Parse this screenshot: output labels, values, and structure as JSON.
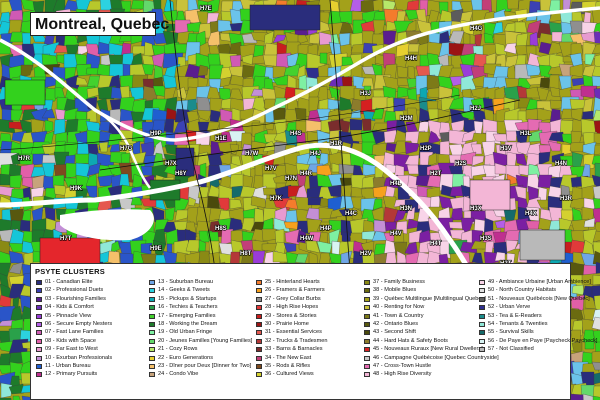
{
  "map": {
    "title": "Montreal, Quebec",
    "colors": {
      "river": "#ffffff",
      "road": "#111111",
      "island_pink": "#f3b6d6",
      "purple_core": "#7b1fa2",
      "olive": "#a3a11a",
      "green_bright": "#33d11d",
      "green_dark": "#1e7b2b",
      "yellow_green": "#b8c82b",
      "red": "#e4262c",
      "blue": "#2a55c8",
      "sky": "#6bc3ea",
      "cyan": "#15c6d8"
    },
    "labels": [
      "H7R",
      "H7T",
      "H7G",
      "H7E",
      "H1E",
      "H7X",
      "H7W",
      "H7V",
      "H7K",
      "H7N",
      "H4J",
      "H4R",
      "H9K",
      "H8Y",
      "H9P",
      "H4S",
      "H1R",
      "H2M",
      "H2P",
      "H2S",
      "H2T",
      "H2J",
      "H3L",
      "H4N",
      "H4L",
      "H3N",
      "H1V",
      "H4V",
      "H4T",
      "H3X",
      "H2V",
      "H3S",
      "H3T",
      "H4X",
      "H3R",
      "H9E",
      "H8T",
      "H8S",
      "H4W",
      "H4P",
      "H4C",
      "H3J",
      "H4H",
      "H4G"
    ]
  },
  "legend": {
    "title": "PSYTE CLUSTERS",
    "columns": [
      [
        {
          "label": "01 - Canadian Elite",
          "color": "#2a2d7c"
        },
        {
          "label": "02 - Professional Duets",
          "color": "#3b41b4"
        },
        {
          "label": "03 - Flourishing Families",
          "color": "#5a1d8f"
        },
        {
          "label": "04 - Kids & Comfort",
          "color": "#6b2db8"
        },
        {
          "label": "05 - Pinnacle View",
          "color": "#9a3cd8"
        },
        {
          "label": "06 - Secure Empty Nesters",
          "color": "#b45ee8"
        },
        {
          "label": "07 - Fast Lane Families",
          "color": "#d05ab4"
        },
        {
          "label": "08 - Kids with Space",
          "color": "#e15fa8"
        },
        {
          "label": "09 - Far East to West",
          "color": "#e89ad0"
        },
        {
          "label": "10 - Exurban Professionals",
          "color": "#c38fd6"
        },
        {
          "label": "11 - Urban Bureau",
          "color": "#1f5fd0"
        },
        {
          "label": "12 - Primary Pursuits",
          "color": "#bf2f8f"
        }
      ],
      [
        {
          "label": "13 - Suburban Bureau",
          "color": "#6fa6e6"
        },
        {
          "label": "14 - Geeks & Tweets",
          "color": "#2cd2e0"
        },
        {
          "label": "15 - Pickups & Startups",
          "color": "#0da8b2"
        },
        {
          "label": "16 - Techies & Teachers",
          "color": "#2aa14a"
        },
        {
          "label": "17 - Emerging Families",
          "color": "#44d12e"
        },
        {
          "label": "18 - Working the Dream",
          "color": "#1e7b2b"
        },
        {
          "label": "19 - Old Urban Fringe",
          "color": "#7ef0a2"
        },
        {
          "label": "20 - Jeunes Familles [Young Families]",
          "color": "#63d86b"
        },
        {
          "label": "21 - Cozy Rows",
          "color": "#b6e86a"
        },
        {
          "label": "22 - Euro Generations",
          "color": "#e6cf2f"
        },
        {
          "label": "23 - Dîner pour Deux [Dinner for Two]",
          "color": "#f5c06a"
        },
        {
          "label": "24 - Condo Vibe",
          "color": "#c7a37b"
        }
      ],
      [
        {
          "label": "25 - Hinterland Hearts",
          "color": "#f47c2c"
        },
        {
          "label": "26 - Framers & Farmers",
          "color": "#f6a11d"
        },
        {
          "label": "27 - Grey Collar Burbs",
          "color": "#8f8f8f"
        },
        {
          "label": "28 - High Rise Hopes",
          "color": "#e13a3a"
        },
        {
          "label": "29 - Stores & Stories",
          "color": "#c81e1e"
        },
        {
          "label": "30 - Prairie Home",
          "color": "#9b1414"
        },
        {
          "label": "31 - Essential Services",
          "color": "#e5584f"
        },
        {
          "label": "32 - Trucks & Tradesmen",
          "color": "#b43838"
        },
        {
          "label": "33 - Barns & Barnacles",
          "color": "#7a2d2d"
        },
        {
          "label": "34 - The New East",
          "color": "#c23f78"
        },
        {
          "label": "35 - Rods & Rifles",
          "color": "#7e4a1e"
        },
        {
          "label": "36 - Cultured Views",
          "color": "#d4d12f"
        }
      ],
      [
        {
          "label": "37 - Family Business",
          "color": "#8a8a14"
        },
        {
          "label": "38 - Mobile Blues",
          "color": "#6b6b10"
        },
        {
          "label": "39 - Québec Multilingue [Multilingual Quebec]",
          "color": "#a3a11a"
        },
        {
          "label": "40 - Renting for Now",
          "color": "#c9c23a"
        },
        {
          "label": "41 - Town & Country",
          "color": "#7d7a18"
        },
        {
          "label": "42 - Ontario Blues",
          "color": "#58580f"
        },
        {
          "label": "43 - Second Shift",
          "color": "#4a4a0c"
        },
        {
          "label": "44 - Hard Hats & Safety Boots",
          "color": "#8c7c2c"
        },
        {
          "label": "45 - Nouveaux Ruraux [New Rural Dwellers]",
          "color": "#d52020"
        },
        {
          "label": "46 - Campagne Québécoise [Quebec Countryside]",
          "color": "#c8c8c8"
        },
        {
          "label": "47 - Cross-Town Hustle",
          "color": "#e46bb2"
        },
        {
          "label": "48 - High Rise Diversity",
          "color": "#f3b6d6"
        }
      ],
      [
        {
          "label": "49 - Ambiance Urbaine [Urban Ambience]",
          "color": "#f8d4e8"
        },
        {
          "label": "50 - North Country Habitats",
          "color": "#e0e0e0"
        },
        {
          "label": "51 - Nouveaux Québécois [New Quebec]",
          "color": "#5c5c5c"
        },
        {
          "label": "52 - Urban Verve",
          "color": "#2f2f8e"
        },
        {
          "label": "53 - Tea & E-Readers",
          "color": "#1a8c8c"
        },
        {
          "label": "54 - Tenants & Twenties",
          "color": "#8fe8d8"
        },
        {
          "label": "55 - Survival Skills",
          "color": "#156b6b"
        },
        {
          "label": "56 - De Paye en Paye [Paycheck Paycheck]",
          "color": "#d9f3f3"
        },
        {
          "label": "57 - Not Classified",
          "color": "#b9b9b9"
        }
      ]
    ]
  }
}
